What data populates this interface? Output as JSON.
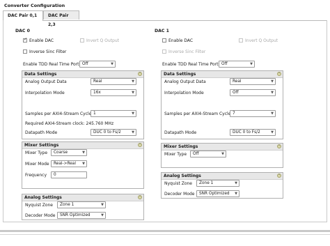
{
  "window": {
    "title": "Converter Configuration"
  },
  "tabs": [
    {
      "label": "DAC Pair 0,1",
      "active": true
    },
    {
      "label": "DAC Pair 2,3",
      "active": false
    }
  ],
  "dac0": {
    "title": "DAC 0",
    "enable_dac": {
      "label": "Enable DAC",
      "checked": true
    },
    "invert_q": {
      "label": "Invert Q Output",
      "checked": false
    },
    "inverse_sinc": {
      "label": "Inverse Sinc Filter",
      "checked": false
    },
    "tdd": {
      "label": "Enable TDD Real Time Ports",
      "value": "Off"
    },
    "data_settings": {
      "title": "Data Settings",
      "analog_output_data": {
        "label": "Analog Output Data",
        "value": "Real"
      },
      "interpolation_mode": {
        "label": "Interpolation Mode",
        "value": "16x"
      },
      "samples_per_cycle": {
        "label": "Samples per AXI4-Stream Cycle",
        "value": "1"
      },
      "required_clock": "Required AXI4-Stream clock: 245.760 MHz",
      "datapath_mode": {
        "label": "Datapath Mode",
        "value": "DUC 0 to Fs/2"
      }
    },
    "mixer_settings": {
      "title": "Mixer Settings",
      "mixer_type": {
        "label": "Mixer Type",
        "value": "Coarse"
      },
      "mixer_mode": {
        "label": "Mixer Mode",
        "value": "Real->Real"
      },
      "frequency": {
        "label": "Frequency",
        "value": "0"
      }
    },
    "analog_settings": {
      "title": "Analog Settings",
      "nyquist_zone": {
        "label": "Nyquist Zone",
        "value": "Zone 1"
      },
      "decoder_mode": {
        "label": "Decoder Mode",
        "value": "SNR Optimized"
      }
    }
  },
  "dac1": {
    "title": "DAC 1",
    "enable_dac": {
      "label": "Enable DAC",
      "checked": false
    },
    "invert_q": {
      "label": "Invert Q Output",
      "checked": false
    },
    "inverse_sinc": {
      "label": "Inverse Sinc Filter",
      "checked": false
    },
    "tdd": {
      "label": "Enable TDD Real Time Ports",
      "value": "Off"
    },
    "data_settings": {
      "title": "Data Settings",
      "analog_output_data": {
        "label": "Analog Output Data",
        "value": "Real"
      },
      "interpolation_mode": {
        "label": "Interpolation Mode",
        "value": "Off"
      },
      "samples_per_cycle": {
        "label": "Samples per AXI4-Stream Cycle",
        "value": "7"
      },
      "datapath_mode": {
        "label": "Datapath Mode",
        "value": "DUC 0 to Fs/2"
      }
    },
    "mixer_settings": {
      "title": "Mixer Settings",
      "mixer_type": {
        "label": "Mixer Type",
        "value": "Off"
      }
    },
    "analog_settings": {
      "title": "Analog Settings",
      "nyquist_zone": {
        "label": "Nyquist Zone",
        "value": "Zone 1"
      },
      "decoder_mode": {
        "label": "Decoder Mode",
        "value": "SNR Optimized"
      }
    }
  },
  "icons": {
    "dropdown": "chevron-down-icon",
    "collapse": "collapse-icon",
    "check": "check-icon"
  }
}
